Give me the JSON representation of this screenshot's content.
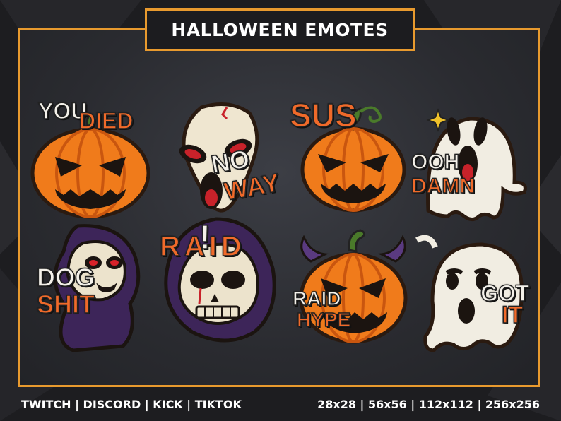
{
  "title": "HALLOWEEN EMOTES",
  "footer": {
    "platforms": "TWITCH | DISCORD | KICK | TIKTOK",
    "sizes": "28x28  | 56x56 | 112x112 | 256x256"
  },
  "colors": {
    "accent": "#e89a2e",
    "panel": "#2e2f34",
    "text_orange": "#f06a2a",
    "text_white": "#f4f1ea"
  },
  "emotes": [
    {
      "icon": "pumpkin-icon",
      "text_white": "YOU",
      "text_orange": "DIED"
    },
    {
      "icon": "skull-mask-icon",
      "text_white": "NO",
      "text_orange": "WAY"
    },
    {
      "icon": "pumpkin-icon",
      "text_white": "",
      "text_orange": "SUS"
    },
    {
      "icon": "ghost-icon",
      "text_white": "OOH",
      "text_orange": "DAMN"
    },
    {
      "icon": "reaper-icon",
      "text_white": "DOG",
      "text_orange": "SHIT"
    },
    {
      "icon": "reaper-skull-icon",
      "text_white": "!",
      "text_orange": "RAID"
    },
    {
      "icon": "horned-pumpkin-icon",
      "text_white": "RAID",
      "text_orange": "HYPE"
    },
    {
      "icon": "ghost-icon",
      "text_white": "GOT",
      "text_orange": "IT"
    }
  ]
}
